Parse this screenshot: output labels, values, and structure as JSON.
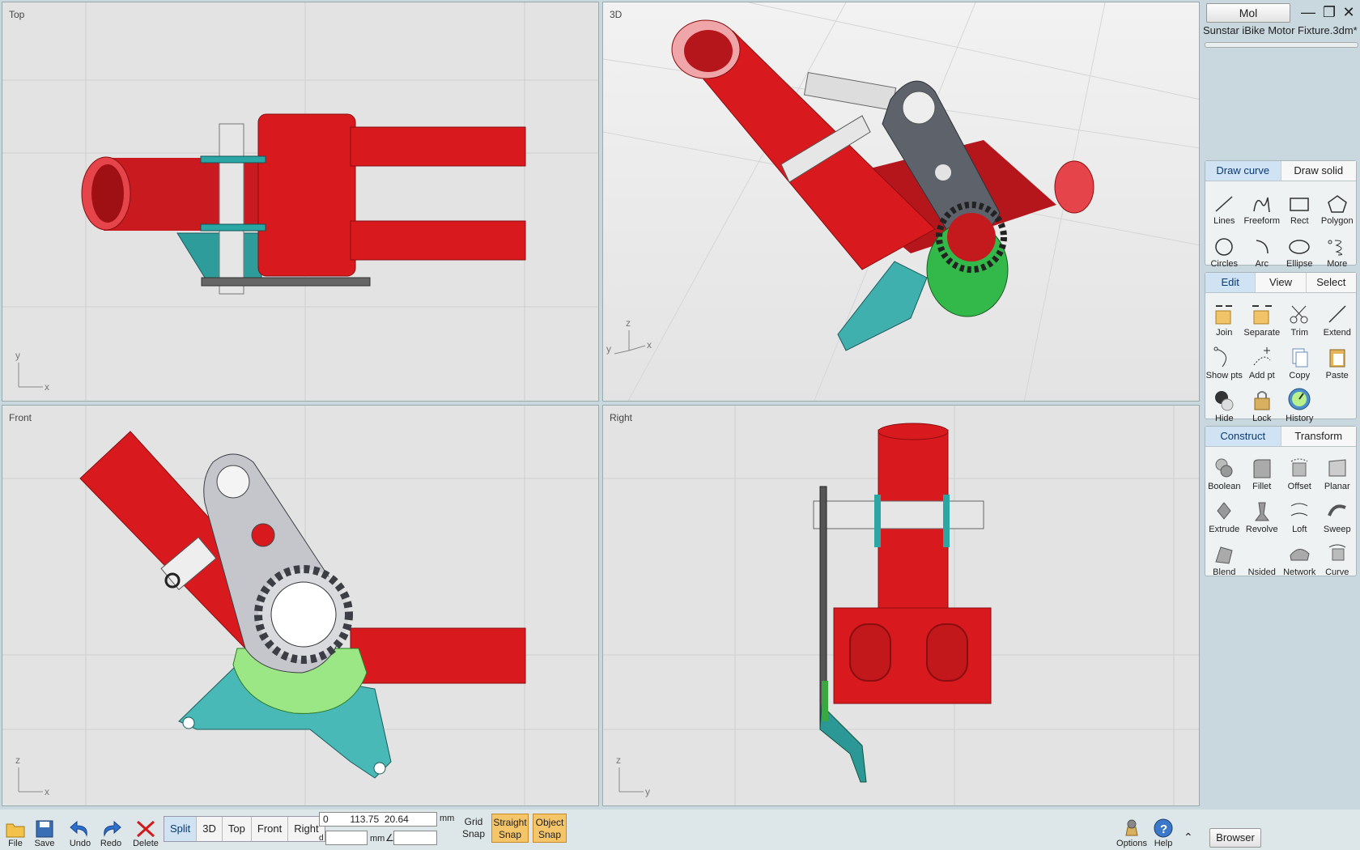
{
  "viewports": {
    "top": {
      "label": "Top",
      "axis_v": "y",
      "axis_h": "x"
    },
    "threed": {
      "label": "3D",
      "axis_v": "z",
      "axis_h": "x",
      "axis_d": "y"
    },
    "front": {
      "label": "Front",
      "axis_v": "z",
      "axis_h": "x"
    },
    "right": {
      "label": "Right",
      "axis_v": "z",
      "axis_h": "y"
    }
  },
  "titlebar": {
    "mode_button": "Mol",
    "document_title": "Sunstar iBike Motor Fixture.3dm*",
    "minimize_icon": "minimize-icon",
    "restore_icon": "restore-icon",
    "close_icon": "close-icon"
  },
  "draw_group": {
    "tabs": [
      "Draw curve",
      "Draw solid"
    ],
    "active_tab": "Draw curve",
    "tools": [
      "Lines",
      "Freeform",
      "Rect",
      "Polygon",
      "Circles",
      "Arc",
      "Ellipse",
      "More"
    ]
  },
  "edit_group": {
    "tabs": [
      "Edit",
      "View",
      "Select"
    ],
    "active_tab": "Edit",
    "tools": [
      "Join",
      "Separate",
      "Trim",
      "Extend",
      "Show pts",
      "Add pt",
      "Copy",
      "Paste",
      "Hide",
      "Lock",
      "History"
    ]
  },
  "construct_group": {
    "tabs": [
      "Construct",
      "Transform"
    ],
    "active_tab": "Construct",
    "tools": [
      "Boolean",
      "Fillet",
      "Offset",
      "Planar",
      "Extrude",
      "Revolve",
      "Loft",
      "Sweep",
      "Blend",
      "Nsided",
      "Network",
      "Curve"
    ]
  },
  "bottombar": {
    "file": "File",
    "save": "Save",
    "undo": "Undo",
    "redo": "Redo",
    "delete": "Delete",
    "views": [
      "Split",
      "3D",
      "Top",
      "Front",
      "Right"
    ],
    "active_view": "Split",
    "coord_value": "0        113.75  20.64",
    "coord_unit": "mm",
    "distance_prefix": "d",
    "distance_value": "",
    "distance_unit": "mm",
    "angle_symbol": "∠",
    "angle_value": "",
    "grid_snap": "Grid\nSnap",
    "straight_snap": "Straight\nSnap",
    "object_snap": "Object\nSnap",
    "options": "Options",
    "help": "Help",
    "browser": "Browser"
  },
  "colors": {
    "tube_red": "#d8191e",
    "plate_gray": "#8f939b",
    "bracket_teal": "#45b3b1",
    "gear_green": "#8ee07a",
    "accent_blue": "#cfe3f5",
    "snap_on": "#f5c56a"
  }
}
